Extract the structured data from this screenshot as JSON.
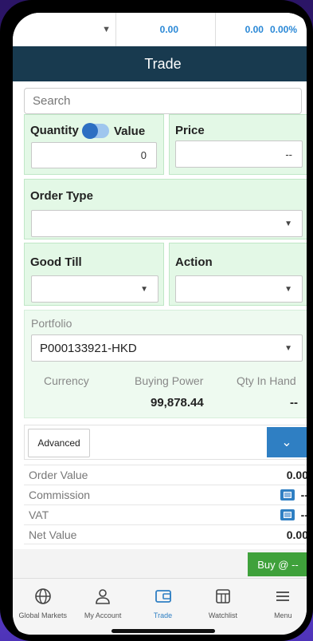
{
  "ticker": {
    "value_1": "0.00",
    "value_2": "0.00",
    "change_pct": "0.00%"
  },
  "header": {
    "title": "Trade"
  },
  "search": {
    "placeholder": "Search"
  },
  "quantity": {
    "label_quantity": "Quantity",
    "label_value": "Value",
    "value": "0"
  },
  "price": {
    "label": "Price",
    "value": "--"
  },
  "order_type": {
    "label": "Order Type",
    "value": ""
  },
  "good_till": {
    "label": "Good Till",
    "value": ""
  },
  "action": {
    "label": "Action",
    "value": ""
  },
  "portfolio": {
    "label": "Portfolio",
    "selected": "P000133921-HKD",
    "currency_label": "Currency",
    "buying_power_label": "Buying Power",
    "qty_in_hand_label": "Qty In Hand",
    "buying_power": "99,878.44",
    "qty_in_hand": "--"
  },
  "advanced": {
    "label": "Advanced"
  },
  "summary": {
    "order_value_label": "Order Value",
    "order_value": "0.00",
    "commission_label": "Commission",
    "commission": "--",
    "vat_label": "VAT",
    "vat": "--",
    "net_value_label": "Net Value",
    "net_value": "0.00"
  },
  "buy_button": {
    "label": "Buy @ --"
  },
  "tabs": [
    {
      "label": "Global Markets",
      "icon": "globe-icon"
    },
    {
      "label": "My Account",
      "icon": "user-icon"
    },
    {
      "label": "Trade",
      "icon": "wallet-icon",
      "active": true
    },
    {
      "label": "Watchlist",
      "icon": "watchlist-icon"
    },
    {
      "label": "Menu",
      "icon": "menu-icon"
    }
  ],
  "colors": {
    "header_bg": "#183a4f",
    "panel_bg": "#e3f8e6",
    "accent_blue": "#2f7fc3",
    "buy_green": "#3fa13b"
  }
}
